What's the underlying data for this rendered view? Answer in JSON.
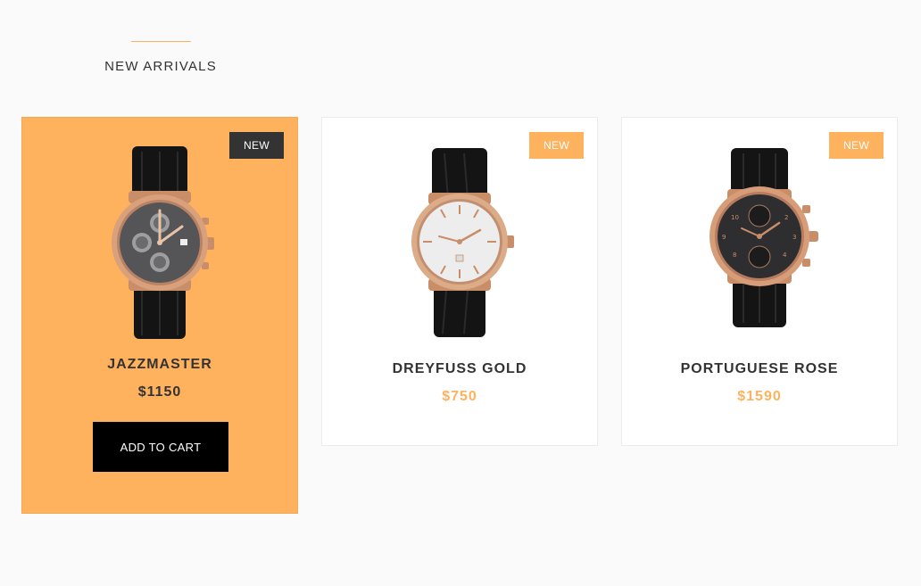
{
  "section": {
    "title": "NEW ARRIVALS"
  },
  "products": [
    {
      "badge": "NEW",
      "name": "JAZZMASTER",
      "price": "$1150",
      "cta": "ADD TO CART",
      "active": true,
      "dial": "chronograph-gray"
    },
    {
      "badge": "NEW",
      "name": "DREYFUSS GOLD",
      "price": "$750",
      "active": false,
      "dial": "silver-simple"
    },
    {
      "badge": "NEW",
      "name": "PORTUGUESE ROSE",
      "price": "$1590",
      "active": false,
      "dial": "chronograph-dark"
    }
  ],
  "colors": {
    "accent": "#ffb25e",
    "dark": "#333333",
    "button": "#000000",
    "background": "#fafafa"
  }
}
